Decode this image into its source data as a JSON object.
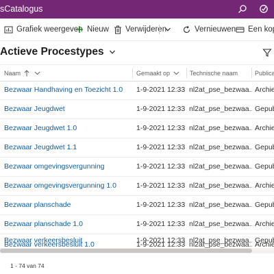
{
  "header": {
    "app_title": "sCatalogus"
  },
  "toolbar": {
    "chart_label": "Grafiek weergeven",
    "new_label": "Nieuw",
    "delete_label": "Verwijderen",
    "refresh_label": "Vernieuwen",
    "link_label": "Een koppe"
  },
  "view": {
    "title": "Actieve Procestypes"
  },
  "columns": {
    "name": "Naam",
    "created": "Gemaakt op",
    "tech": "Technische naam",
    "pub": "Publicat"
  },
  "rows": [
    {
      "name": "Bezwaar Handhaving en Toezicht 1.0",
      "created": "1-9-2021 12:33",
      "tech": "nl2at_pse_bezwaa...",
      "pub": "Archie"
    },
    {
      "name": "Bezwaar Jeugdwet",
      "created": "1-9-2021 12:33",
      "tech": "nl2at_pse_bezwaa...",
      "pub": "Gepub"
    },
    {
      "name": "Bezwaar Jeugdwet 1.0",
      "created": "1-9-2021 12:33",
      "tech": "nl2at_pse_bezwaa...",
      "pub": "Archie"
    },
    {
      "name": "Bezwaar Jeugdwet 1.1",
      "created": "1-9-2021 12:33",
      "tech": "nl2at_pse_bezwaa...",
      "pub": "Gepub"
    },
    {
      "name": "Bezwaar omgevingsvergunning",
      "created": "1-9-2021 12:33",
      "tech": "nl2at_pse_bezwaa...",
      "pub": "Gepub"
    },
    {
      "name": "Bezwaar omgevingsvergunning 1.0",
      "created": "1-9-2021 12:33",
      "tech": "nl2at_pse_bezwaa...",
      "pub": "Archie"
    },
    {
      "name": "Bezwaar planschade",
      "created": "1-9-2021 12:33",
      "tech": "nl2at_pse_bezwaa...",
      "pub": "Gepub"
    },
    {
      "name": "Bezwaar planschade 1.0",
      "created": "1-9-2021 12:33",
      "tech": "nl2at_pse_bezwaa...",
      "pub": "Archie"
    },
    {
      "name": "Bezwaar verkeersbesluit",
      "created": "1-9-2021 12:33",
      "tech": "nl2at_pse_bezwaa...",
      "pub": "Gepub"
    },
    {
      "name": "Bezwaar verkeersbesluit 1.0",
      "created": "1-9-2021 12:33",
      "tech": "nl2at_pse_bezwaa...",
      "pub": "Archie"
    }
  ],
  "footer": {
    "record_count": "1 - 74 van 74"
  },
  "colors": {
    "brand": "#742774",
    "link": "#115ea3",
    "text": "#323130",
    "muted": "#605e5c",
    "border": "#edebe9"
  },
  "icons": [
    "search-icon",
    "assistant-icon",
    "chart-icon",
    "plus-icon",
    "trash-icon",
    "chevron-down-icon",
    "refresh-icon",
    "link-icon",
    "filter-icon",
    "sort-up-icon"
  ]
}
